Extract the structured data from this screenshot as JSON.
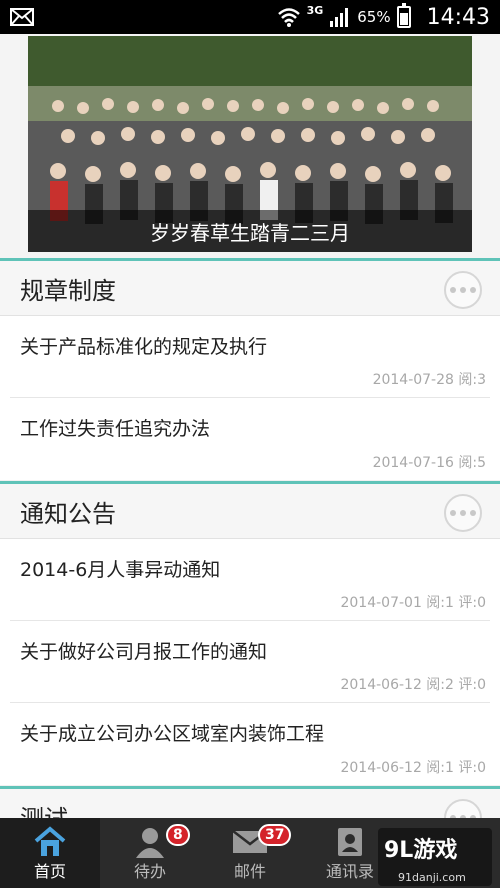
{
  "status_bar": {
    "network": "3G",
    "battery": "65%",
    "time": "14:43"
  },
  "banner": {
    "caption": "岁岁春草生踏青二三月"
  },
  "sections": [
    {
      "title": "规章制度",
      "items": [
        {
          "title": "关于产品标准化的规定及执行",
          "meta": "2014-07-28 阅:3"
        },
        {
          "title": "工作过失责任追究办法",
          "meta": "2014-07-16 阅:5"
        }
      ]
    },
    {
      "title": "通知公告",
      "items": [
        {
          "title": "2014-6月人事异动通知",
          "meta": "2014-07-01 阅:1 评:0"
        },
        {
          "title": "关于做好公司月报工作的通知",
          "meta": "2014-06-12 阅:2 评:0"
        },
        {
          "title": "关于成立公司办公区域室内装饰工程",
          "meta": "2014-06-12 阅:1 评:0"
        }
      ]
    },
    {
      "title": "测试",
      "items": []
    }
  ],
  "bottom_nav": [
    {
      "label": "首页",
      "icon": "home-icon",
      "badge": ""
    },
    {
      "label": "待办",
      "icon": "user-icon",
      "badge": "8"
    },
    {
      "label": "邮件",
      "icon": "mail-icon",
      "badge": "37"
    },
    {
      "label": "通讯录",
      "icon": "contacts-icon",
      "badge": ""
    }
  ],
  "watermark": {
    "logo": "9L游戏",
    "url": "91danji.com"
  },
  "colors": {
    "accent": "#5fc3b8",
    "badge": "#d4232a",
    "nav_bg": "#2b2b2b"
  }
}
